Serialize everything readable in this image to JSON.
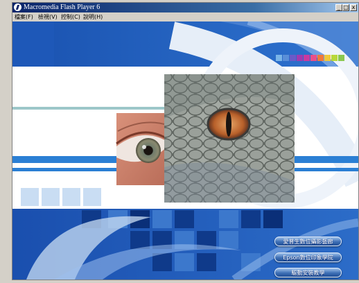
{
  "window": {
    "title": "Macromedia Flash Player 6",
    "controls": {
      "minimize": "_",
      "maximize": "□",
      "close": "x"
    }
  },
  "menu": {
    "items": [
      {
        "label": "檔案(F)"
      },
      {
        "label": "檢視(V)"
      },
      {
        "label": "控制(C)"
      },
      {
        "label": "說明(H)"
      }
    ]
  },
  "stage": {
    "colors": {
      "primary_blue": "#1d5fbf",
      "light_blue": "#6aa0e0",
      "band_blue": "#2b7fd4",
      "teal_line": "#9cc7c9"
    },
    "swatch_colors": [
      "#7ab5e8",
      "#5a8fd8",
      "#6a5ac8",
      "#a03ab0",
      "#c83aa0",
      "#e8508a",
      "#f07a3a",
      "#f0c83a",
      "#b8d83a",
      "#8ac850"
    ],
    "buttons": [
      {
        "label": "愛普生數位攝影藝廊"
      },
      {
        "label": "Epson數位印象學院"
      },
      {
        "label": "驅動安裝教學"
      }
    ]
  }
}
